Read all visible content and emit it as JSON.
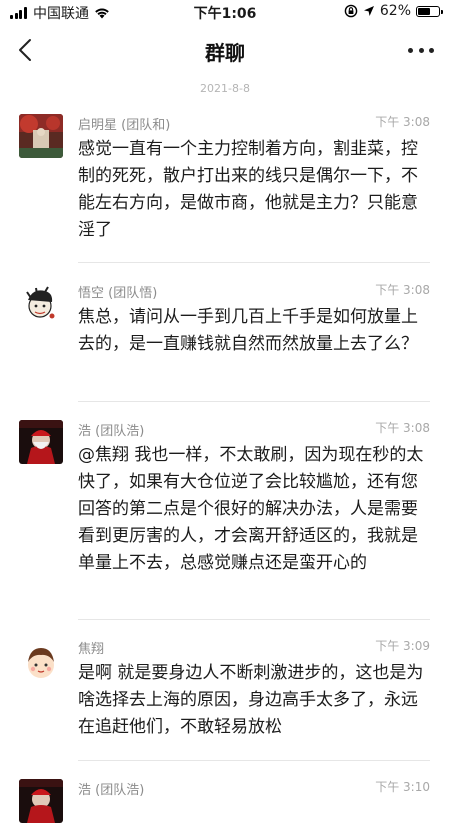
{
  "status_bar": {
    "carrier": "中国联通",
    "time": "下午1:06",
    "battery_percent": "62%",
    "battery_level": 0.62,
    "icons": [
      "signal-icon",
      "wifi-icon",
      "lock-rotation-icon",
      "location-icon",
      "battery-icon"
    ]
  },
  "nav": {
    "title": "群聊",
    "back_icon": "chevron-left-icon",
    "more_icon": "more-horizontal-icon"
  },
  "date_divider": "2021-8-8",
  "messages": [
    {
      "sender": "启明星 (团队和)",
      "time": "下午 3:08",
      "text": "感觉一直有一个主力控制着方向，割韭菜，控制的死死，散户打出来的线只是偶尔一下，不能左右方向，是做市商，他就是主力？只能意淫了"
    },
    {
      "sender": "悟空 (团队悟)",
      "time": "下午 3:08",
      "text": "焦总，请问从一手到几百上千手是如何放量上去的，是一直赚钱就自然而然放量上去了么？"
    },
    {
      "sender": "浩 (团队浩)",
      "time": "下午 3:08",
      "text": "@焦翔 我也一样，不太敢刷，因为现在秒的太快了，如果有大仓位逆了会比较尴尬，还有您回答的第二点是个很好的解决办法，人是需要看到更厉害的人，才会离开舒适区的，我就是单量上不去，总感觉赚点还是蛮开心的"
    },
    {
      "sender": "焦翔",
      "time": "下午 3:09",
      "text": "是啊 就是要身边人不断刺激进步的，这也是为啥选择去上海的原因，身边高手太多了，永远在追赶他们，不敢轻易放松"
    },
    {
      "sender": "浩 (团队浩)",
      "time": "下午 3:10",
      "text": ""
    }
  ]
}
